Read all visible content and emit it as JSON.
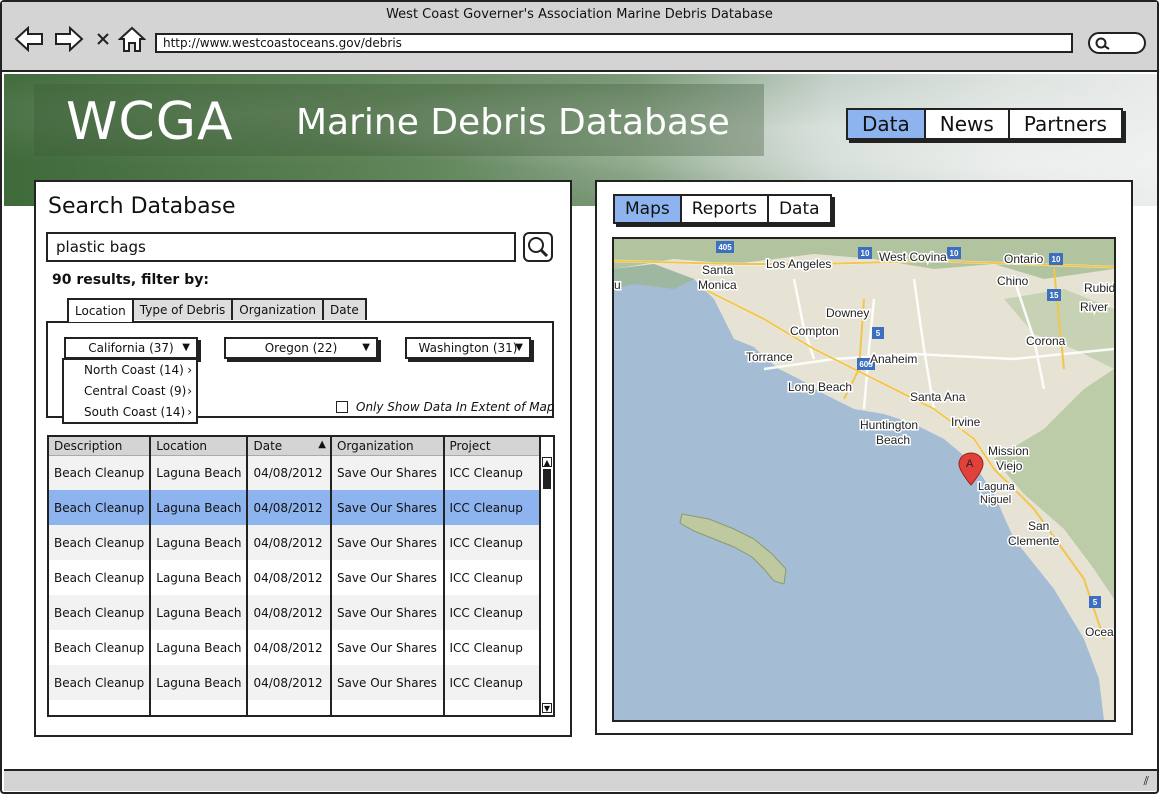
{
  "browser": {
    "title": "West Coast Governer's Association Marine Debris Database",
    "url": "http://www.westcoastoceans.gov/debris"
  },
  "header": {
    "logo": "WCGA",
    "title": "Marine Debris Database",
    "nav": [
      "Data",
      "News",
      "Partners"
    ],
    "active_nav": "Data"
  },
  "search": {
    "title": "Search Database",
    "query": "plastic bags",
    "results_text": "90 results, filter by:"
  },
  "filters": {
    "tabs": [
      "Location",
      "Type of Debris",
      "Organization",
      "Date"
    ],
    "active_tab": "Location",
    "selects": [
      "California (37)",
      "Oregon (22)",
      "Washington (31)"
    ],
    "dropdown_items": [
      "North Coast  (14)",
      "Central Coast  (9)",
      "South Coast  (14)"
    ],
    "extent_label": "Only Show Data In Extent of Map"
  },
  "table": {
    "columns": [
      "Description",
      "Location",
      "Date",
      "Organization",
      "Project"
    ],
    "rows": [
      [
        "Beach Cleanup",
        "Laguna Beach",
        "04/08/2012",
        "Save Our Shares",
        "ICC Cleanup"
      ],
      [
        "Beach Cleanup",
        "Laguna Beach",
        "04/08/2012",
        "Save Our Shares",
        "ICC Cleanup"
      ],
      [
        "Beach Cleanup",
        "Laguna Beach",
        "04/08/2012",
        "Save Our Shares",
        "ICC Cleanup"
      ],
      [
        "Beach Cleanup",
        "Laguna Beach",
        "04/08/2012",
        "Save Our Shares",
        "ICC Cleanup"
      ],
      [
        "Beach Cleanup",
        "Laguna Beach",
        "04/08/2012",
        "Save Our Shares",
        "ICC Cleanup"
      ],
      [
        "Beach Cleanup",
        "Laguna Beach",
        "04/08/2012",
        "Save Our Shares",
        "ICC Cleanup"
      ],
      [
        "Beach Cleanup",
        "Laguna Beach",
        "04/08/2012",
        "Save Our Shares",
        "ICC Cleanup"
      ]
    ],
    "selected_row": 1
  },
  "results_view": {
    "tabs": [
      "Maps",
      "Reports",
      "Data"
    ],
    "active_tab": "Maps"
  },
  "map": {
    "labels": [
      "Santa Monica",
      "Los Angeles",
      "West Covina",
      "Ontario",
      "Chino",
      "Rubid",
      "River",
      "Downey",
      "Compton",
      "Torrance",
      "Anaheim",
      "Corona",
      "Long Beach",
      "Santa Ana",
      "Irvine",
      "Huntington Beach",
      "Mission Viejo",
      "Laguna Niguel",
      "San Clemente",
      "Ocea",
      "u"
    ],
    "highways": [
      "405",
      "10",
      "10",
      "10",
      "15",
      "5",
      "605",
      "5"
    ],
    "marker": "A"
  },
  "colors": {
    "accent": "#8db4ee",
    "chrome": "#d4d4d4",
    "water": "#a4bdd4",
    "land": "#e6e3d4"
  }
}
